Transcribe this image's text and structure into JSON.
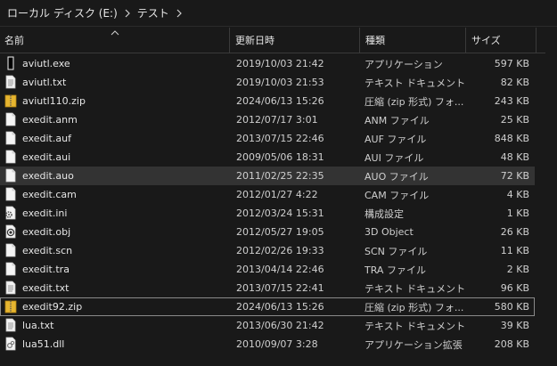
{
  "breadcrumb": {
    "drive": "ローカル ディスク (E:)",
    "folder": "テスト"
  },
  "columns": {
    "name": "名前",
    "date": "更新日時",
    "type": "種類",
    "size": "サイズ"
  },
  "files": [
    {
      "name": "aviutl.exe",
      "date": "2019/10/03 21:42",
      "type": "アプリケーション",
      "size": "597 KB",
      "icon": "exe"
    },
    {
      "name": "aviutl.txt",
      "date": "2019/10/03 21:53",
      "type": "テキスト ドキュメント",
      "size": "82 KB",
      "icon": "txt"
    },
    {
      "name": "aviutl110.zip",
      "date": "2024/06/13 15:26",
      "type": "圧縮 (zip 形式) フォ...",
      "size": "243 KB",
      "icon": "zip"
    },
    {
      "name": "exedit.anm",
      "date": "2012/07/17 3:01",
      "type": "ANM ファイル",
      "size": "25 KB",
      "icon": "file"
    },
    {
      "name": "exedit.auf",
      "date": "2013/07/15 22:46",
      "type": "AUF ファイル",
      "size": "848 KB",
      "icon": "file"
    },
    {
      "name": "exedit.aui",
      "date": "2009/05/06 18:31",
      "type": "AUI ファイル",
      "size": "48 KB",
      "icon": "file"
    },
    {
      "name": "exedit.auo",
      "date": "2011/02/25 22:35",
      "type": "AUO ファイル",
      "size": "72 KB",
      "icon": "file",
      "state": "hover"
    },
    {
      "name": "exedit.cam",
      "date": "2012/01/27 4:22",
      "type": "CAM ファイル",
      "size": "4 KB",
      "icon": "file"
    },
    {
      "name": "exedit.ini",
      "date": "2012/03/24 15:31",
      "type": "構成設定",
      "size": "1 KB",
      "icon": "ini"
    },
    {
      "name": "exedit.obj",
      "date": "2012/05/27 19:05",
      "type": "3D Object",
      "size": "26 KB",
      "icon": "obj"
    },
    {
      "name": "exedit.scn",
      "date": "2012/02/26 19:33",
      "type": "SCN ファイル",
      "size": "11 KB",
      "icon": "file"
    },
    {
      "name": "exedit.tra",
      "date": "2013/04/14 22:46",
      "type": "TRA ファイル",
      "size": "2 KB",
      "icon": "file"
    },
    {
      "name": "exedit.txt",
      "date": "2013/07/15 22:41",
      "type": "テキスト ドキュメント",
      "size": "96 KB",
      "icon": "txt"
    },
    {
      "name": "exedit92.zip",
      "date": "2024/06/13 15:26",
      "type": "圧縮 (zip 形式) フォ...",
      "size": "580 KB",
      "icon": "zip",
      "state": "focus"
    },
    {
      "name": "lua.txt",
      "date": "2013/06/30 21:42",
      "type": "テキスト ドキュメント",
      "size": "39 KB",
      "icon": "txt"
    },
    {
      "name": "lua51.dll",
      "date": "2010/09/07 3:28",
      "type": "アプリケーション拡張",
      "size": "208 KB",
      "icon": "dll"
    }
  ]
}
